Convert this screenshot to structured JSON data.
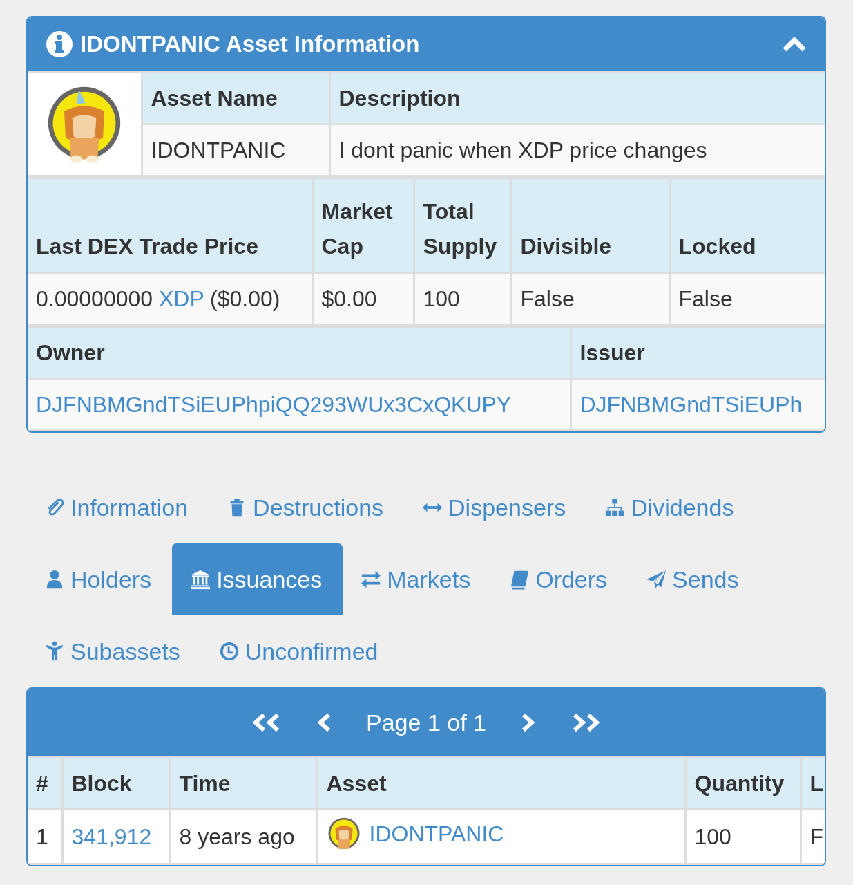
{
  "panel": {
    "title": "IDONTPANIC Asset Information",
    "expanded": true
  },
  "asset": {
    "columns": [
      "Asset Name",
      "Description"
    ],
    "values": [
      "IDONTPANIC",
      "I dont panic when XDP price changes"
    ]
  },
  "market": {
    "columns": [
      "Last DEX Trade Price",
      "Market Cap",
      "Total Supply",
      "Divisible",
      "Locked"
    ],
    "values": [
      [
        {
          "kind": "text",
          "text": "0.00000000 "
        },
        {
          "kind": "link",
          "text": "XDP"
        },
        {
          "kind": "text",
          "text": " ($0.00)"
        }
      ],
      [
        {
          "kind": "text",
          "text": "$0.00"
        }
      ],
      [
        {
          "kind": "text",
          "text": "100"
        }
      ],
      [
        {
          "kind": "text",
          "text": "False"
        }
      ],
      [
        {
          "kind": "text",
          "text": "False"
        }
      ]
    ]
  },
  "parties": {
    "columns": [
      "Owner",
      "Issuer"
    ],
    "values": [
      "DJFNBMGndTSiEUPhpiQQ293WUx3CxQKUPY",
      "DJFNBMGndTSiEUPh"
    ]
  },
  "tabs": [
    {
      "label": "Information",
      "selected": false
    },
    {
      "label": "Destructions",
      "selected": false
    },
    {
      "label": "Dispensers",
      "selected": false
    },
    {
      "label": "Dividends",
      "selected": false
    },
    {
      "label": "Holders",
      "selected": false
    },
    {
      "label": "Issuances",
      "selected": true
    },
    {
      "label": "Markets",
      "selected": false
    },
    {
      "label": "Orders",
      "selected": false
    },
    {
      "label": "Sends",
      "selected": false
    },
    {
      "label": "Subassets",
      "selected": false
    },
    {
      "label": "Unconfirmed",
      "selected": false
    }
  ],
  "pager": {
    "label": "Page 1 of 1"
  },
  "issuances": {
    "columns": [
      "#",
      "Block",
      "Time",
      "Asset",
      "Quantity",
      "L"
    ],
    "rows": [
      {
        "cells": [
          "1",
          "341,912",
          "8 years ago",
          "IDONTPANIC",
          "100",
          "F"
        ]
      }
    ]
  }
}
